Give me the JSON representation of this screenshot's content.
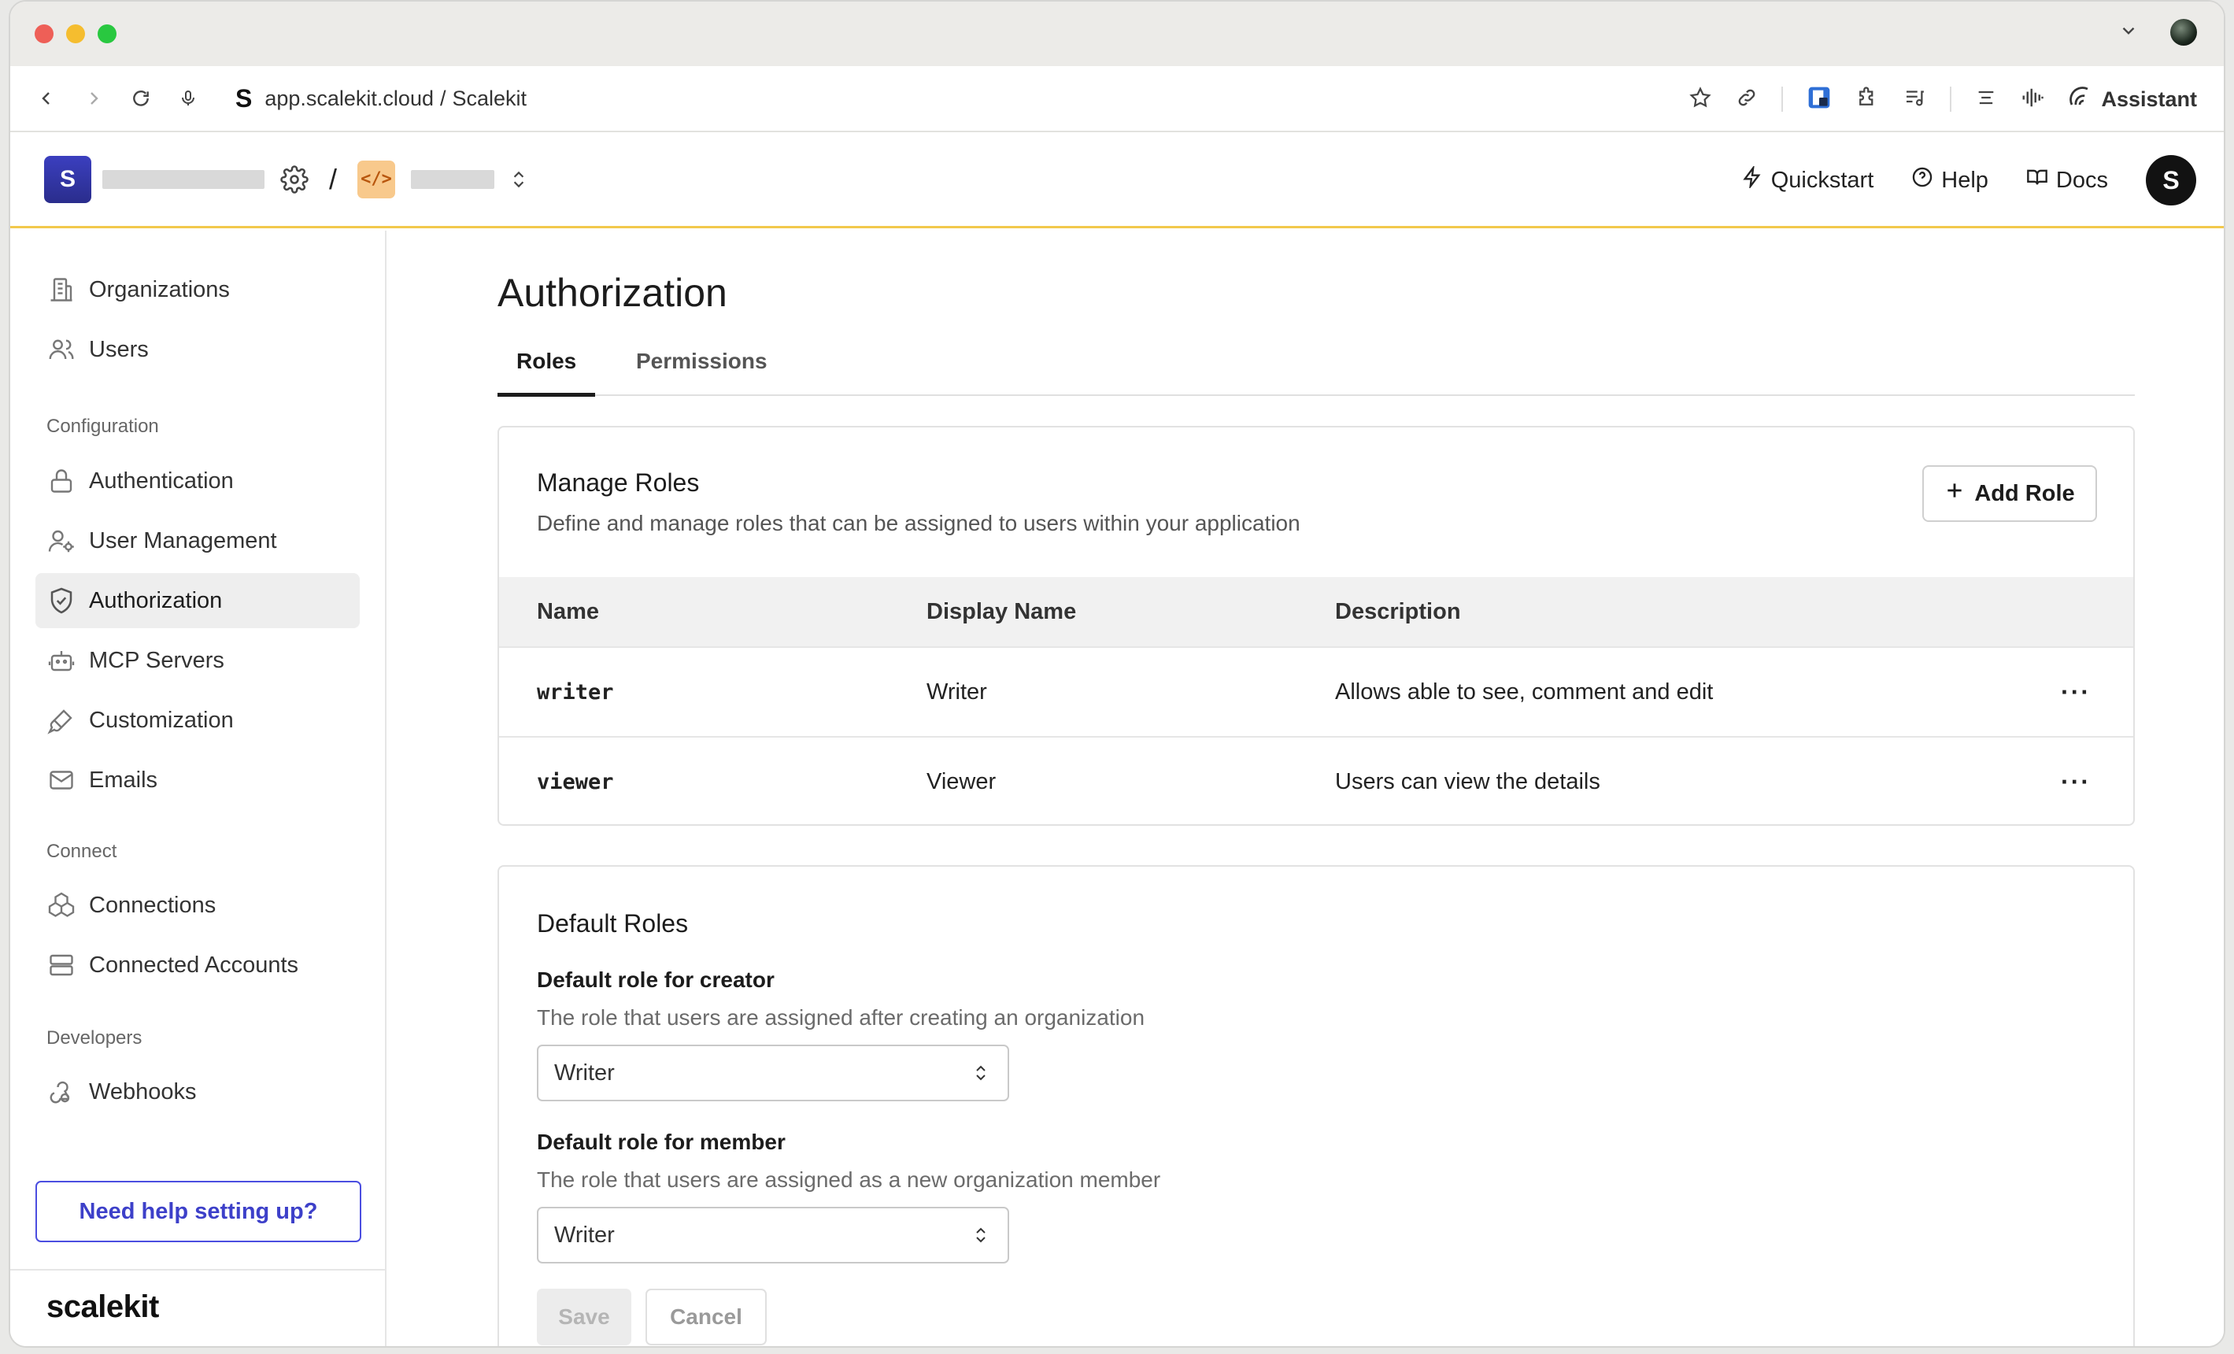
{
  "browser": {
    "url_host": "app.scalekit.cloud",
    "url_separator": "/",
    "url_page": "Scalekit",
    "site_icon": "S",
    "assistant_label": "Assistant"
  },
  "header": {
    "workspace_initial": "S",
    "path_separator": "/",
    "quickstart": "Quickstart",
    "help": "Help",
    "docs": "Docs",
    "avatar_initial": "S"
  },
  "sidebar": {
    "items_top": [
      {
        "label": "Organizations",
        "icon": "building-icon"
      },
      {
        "label": "Users",
        "icon": "users-icon"
      }
    ],
    "section_configuration": "Configuration",
    "items_config": [
      {
        "label": "Authentication",
        "icon": "lock-icon"
      },
      {
        "label": "User Management",
        "icon": "user-gear-icon"
      },
      {
        "label": "Authorization",
        "icon": "shield-check-icon"
      },
      {
        "label": "MCP Servers",
        "icon": "robot-icon"
      },
      {
        "label": "Customization",
        "icon": "paintbrush-icon"
      },
      {
        "label": "Emails",
        "icon": "mail-icon"
      }
    ],
    "section_connect": "Connect",
    "items_connect": [
      {
        "label": "Connections",
        "icon": "boxes-icon"
      },
      {
        "label": "Connected Accounts",
        "icon": "server-icon"
      }
    ],
    "section_developers": "Developers",
    "items_dev": [
      {
        "label": "Webhooks",
        "icon": "webhook-icon"
      }
    ],
    "help_button": "Need help setting up?",
    "brand": "scalekit"
  },
  "main": {
    "title": "Authorization",
    "tabs": [
      "Roles",
      "Permissions"
    ],
    "manage": {
      "title": "Manage Roles",
      "subtitle": "Define and manage roles that can be assigned to users within your application",
      "add_button": "Add Role",
      "columns": [
        "Name",
        "Display Name",
        "Description"
      ],
      "rows": [
        {
          "name": "writer",
          "display": "Writer",
          "description": "Allows able to see, comment and edit"
        },
        {
          "name": "viewer",
          "display": "Viewer",
          "description": "Users can view the details"
        }
      ],
      "more_label": "···"
    },
    "defaults": {
      "title": "Default Roles",
      "creator_label": "Default role for creator",
      "creator_help": "The role that users are assigned after creating an organization",
      "creator_value": "Writer",
      "member_label": "Default role for member",
      "member_help": "The role that users are assigned as a new organization member",
      "member_value": "Writer",
      "save": "Save",
      "cancel": "Cancel"
    }
  },
  "colors": {
    "accent": "#4b4ee0",
    "header_border": "#f2c94c",
    "workspace_badge": "#3b3fbf",
    "env_badge": "#f8c98c"
  }
}
